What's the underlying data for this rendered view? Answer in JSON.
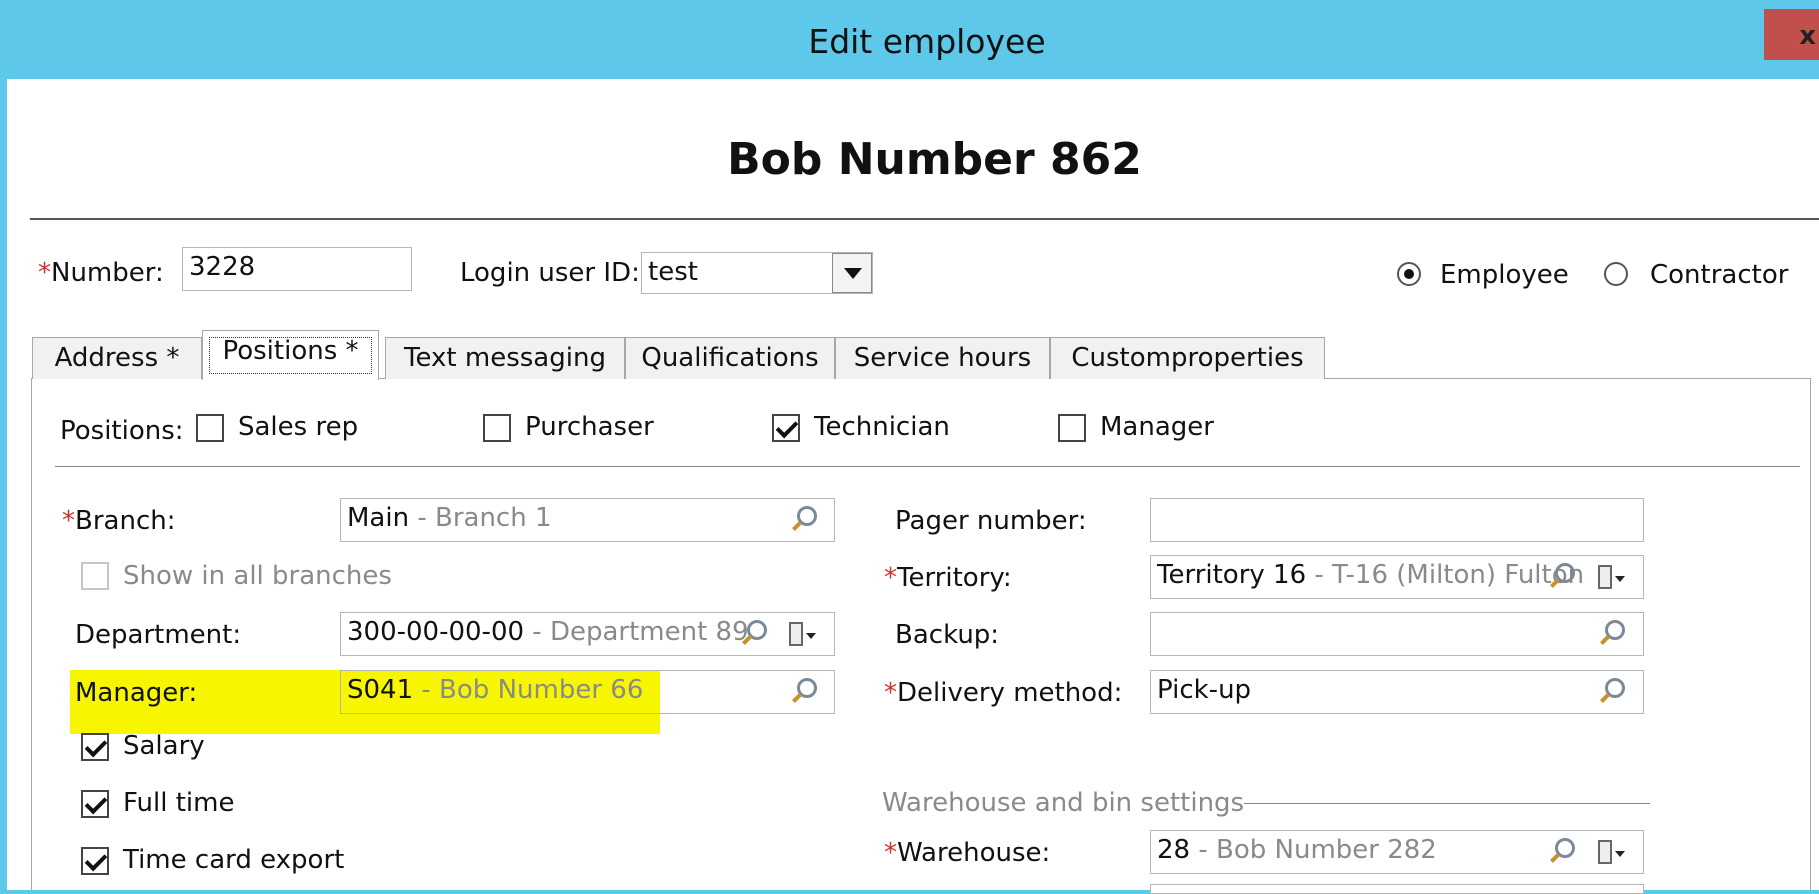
{
  "window": {
    "title": "Edit employee",
    "close_label": "x"
  },
  "employee": {
    "name": "Bob Number 862"
  },
  "header": {
    "number_label": "Number:",
    "number_value": "3228",
    "login_label": "Login user ID:",
    "login_value": "test",
    "type_options": [
      {
        "label": "Employee",
        "selected": true
      },
      {
        "label": "Contractor",
        "selected": false
      }
    ]
  },
  "tabs": [
    {
      "label": "Address *",
      "active": false
    },
    {
      "label": "Positions *",
      "active": true
    },
    {
      "label": "Text messaging",
      "active": false
    },
    {
      "label": "Qualifications",
      "active": false
    },
    {
      "label": "Service hours",
      "active": false
    },
    {
      "label": "Customproperties",
      "active": false
    }
  ],
  "positions": {
    "label": "Positions:",
    "items": [
      {
        "label": "Sales rep",
        "checked": false
      },
      {
        "label": "Purchaser",
        "checked": false
      },
      {
        "label": "Technician",
        "checked": true
      },
      {
        "label": "Manager",
        "checked": false
      }
    ]
  },
  "left": {
    "branch_label": "Branch:",
    "branch_code": "Main",
    "branch_desc": " - Branch 1",
    "show_all_branches": "Show in all branches",
    "department_label": "Department:",
    "department_code": "300-00-00-00",
    "department_desc": " - Department 89",
    "manager_label": "Manager:",
    "manager_code": "S041",
    "manager_desc": " - Bob Number 66",
    "salary": "Salary",
    "full_time": "Full time",
    "time_card_export": "Time card export"
  },
  "right": {
    "pager_label": "Pager number:",
    "pager_value": "",
    "territory_label": "Territory:",
    "territory_code": "Territory 16",
    "territory_desc": " - T-16 (Milton) Fulton",
    "backup_label": "Backup:",
    "backup_value": "",
    "delivery_label": "Delivery method:",
    "delivery_value": "Pick-up",
    "warehouse_section": "Warehouse and bin settings",
    "warehouse_label": "Warehouse:",
    "warehouse_code": "28",
    "warehouse_desc": " - Bob Number 282"
  },
  "icons": {
    "lookup": "magnifier-icon",
    "dropdown": "flag-dropdown-icon"
  },
  "colors": {
    "titlebar": "#5ec8ea",
    "close": "#c1504d",
    "required": "#d3312b",
    "highlight": "#f7f600"
  }
}
